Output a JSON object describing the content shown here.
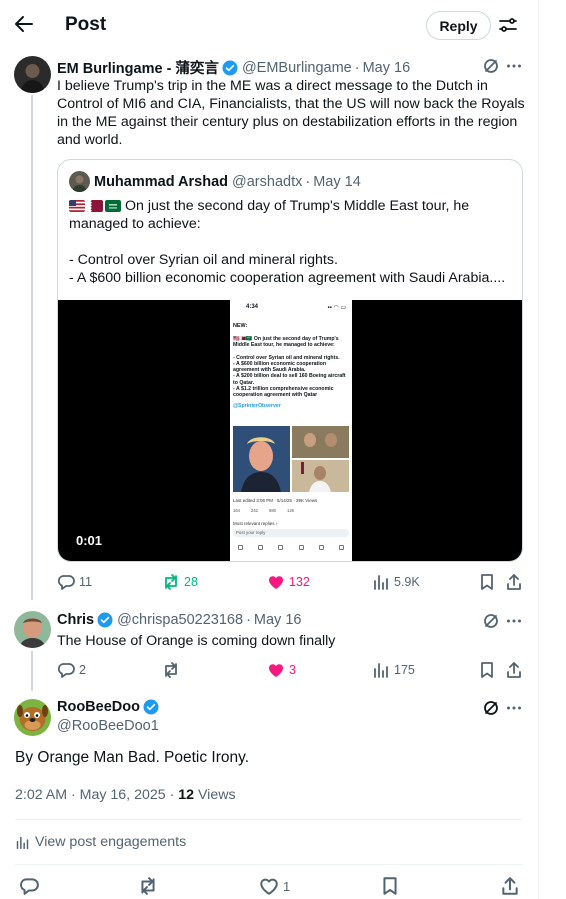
{
  "header": {
    "title": "Post",
    "reply_label": "Reply"
  },
  "post1": {
    "name": "EM Burlingame - 蒲奕言",
    "handle": "@EMBurlingame",
    "date": "May 16",
    "text": "I believe Trump's trip in the ME was a direct message to the Dutch in Control of MI6 and CIA, Financialists, that the US will now back the Royals in the ME against their century plus on destabilization efforts in the region and world.",
    "quote": {
      "name": "Muhammad Arshad",
      "handle": "@arshadtx",
      "date": "May 14",
      "line1": "On just the second day of Trump's Middle East tour, he managed to achieve:",
      "line2": "- Control over Syrian oil and mineral rights.",
      "line3": "- A $600 billion economic cooperation agreement with Saudi Arabia....",
      "video_time": "0:01",
      "phone": {
        "time": "4:34",
        "new": "NEW:",
        "body_lines": [
          "🇺🇸🇶🇦🇸🇦 On just the second day of Trump's",
          "Middle East tour, he managed to achieve:",
          "",
          "- Control over Syrian oil and mineral rights.",
          "- A $600 billion economic cooperation",
          "agreement with Saudi Arabia.",
          "- A $200 billion deal to sell 160 Boeing aircraft",
          "to Qatar.",
          "- A $1.2 trillion comprehensive economic",
          "cooperation agreement with Qatar"
        ],
        "mention": "@SprinterObserver",
        "meta": "Last edited 3:06 PM · 5/14/25 · 39K Views",
        "stats": [
          "164",
          "242",
          "680",
          "126"
        ],
        "relevant": "Most relevant replies ›",
        "reply_placeholder": "Post your reply"
      }
    },
    "actions": {
      "replies": "11",
      "reposts": "28",
      "likes": "132",
      "views": "5.9K"
    }
  },
  "post2": {
    "name": "Chris",
    "handle": "@chrispa50223168",
    "date": "May 16",
    "text": "The House of Orange is coming down finally",
    "actions": {
      "replies": "2",
      "reposts": "",
      "likes": "3",
      "views": "175"
    }
  },
  "focused": {
    "name": "RooBeeDoo",
    "handle": "@RooBeeDoo1",
    "text": "By Orange Man Bad. Poetic Irony.",
    "timestamp": "2:02 AM · May 16, 2025 · ",
    "views_count": "12",
    "views_label": " Views",
    "engagements": "View post engagements",
    "likes": "1"
  },
  "colors": {
    "accent": "#1d9bf0",
    "repost": "#00ba7c",
    "like": "#f91880",
    "muted": "#536471"
  }
}
